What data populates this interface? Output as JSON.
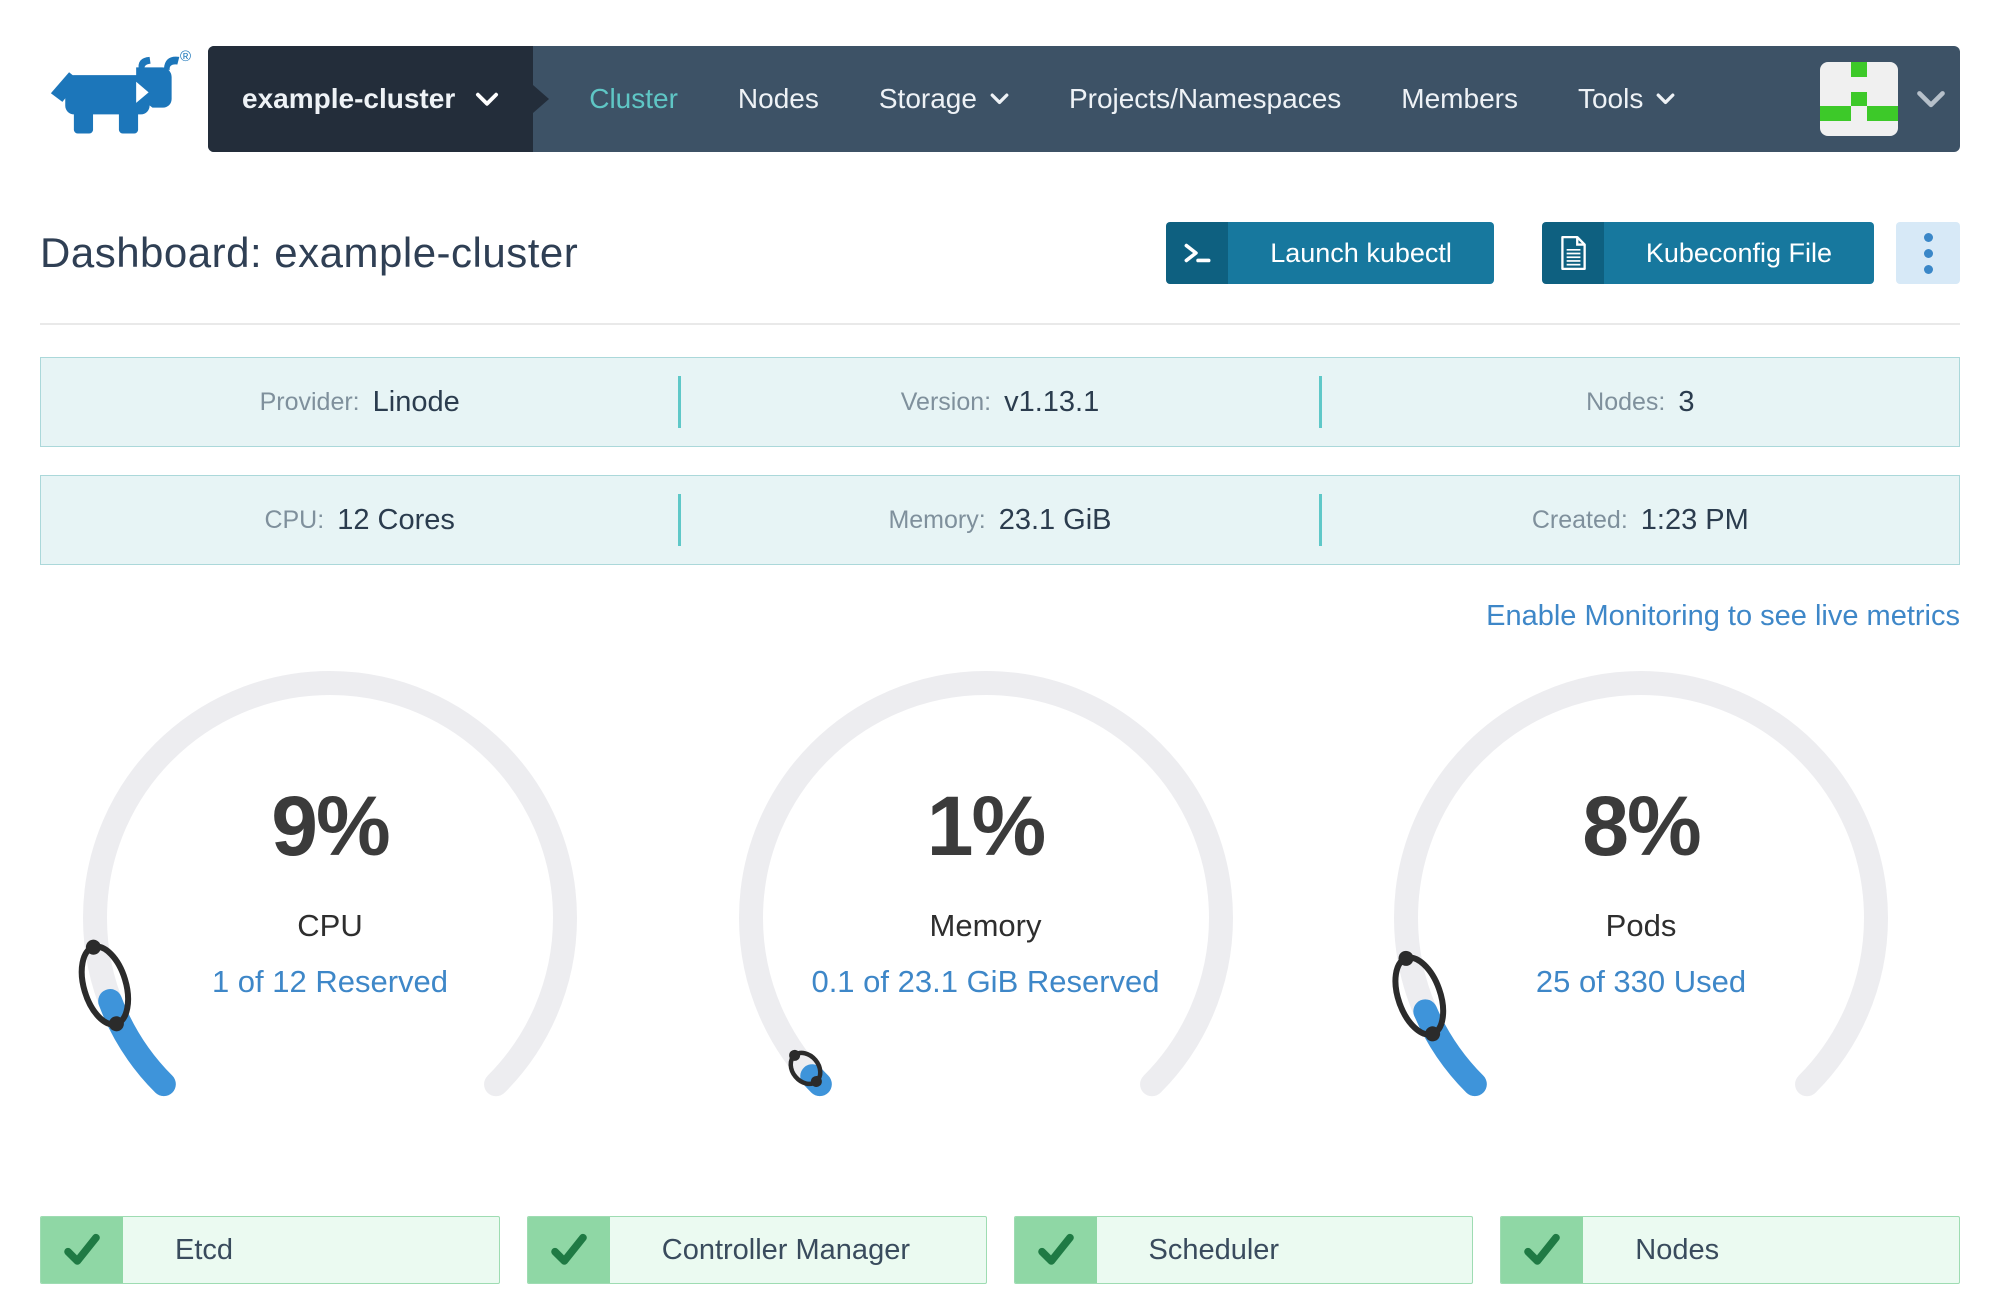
{
  "brand": {
    "trademark": "®"
  },
  "nav": {
    "cluster_selector": {
      "label": "example-cluster"
    },
    "items": [
      {
        "label": "Cluster",
        "active": true,
        "caret": false
      },
      {
        "label": "Nodes",
        "active": false,
        "caret": false
      },
      {
        "label": "Storage",
        "active": false,
        "caret": true
      },
      {
        "label": "Projects/Namespaces",
        "active": false,
        "caret": false
      },
      {
        "label": "Members",
        "active": false,
        "caret": false
      },
      {
        "label": "Tools",
        "active": false,
        "caret": true
      }
    ],
    "avatar_pattern": [
      [
        0,
        0,
        1,
        0,
        0
      ],
      [
        0,
        0,
        0,
        0,
        0
      ],
      [
        0,
        0,
        1,
        0,
        0
      ],
      [
        1,
        1,
        0,
        1,
        1
      ],
      [
        0,
        0,
        0,
        0,
        0
      ]
    ]
  },
  "header": {
    "title": "Dashboard: example-cluster",
    "actions": {
      "launch_kubectl": "Launch kubectl",
      "kubeconfig": "Kubeconfig File"
    }
  },
  "info_rows": [
    {
      "cells": [
        {
          "label": "Provider:",
          "value": "Linode"
        },
        {
          "label": "Version:",
          "value": "v1.13.1"
        },
        {
          "label": "Nodes:",
          "value": "3"
        }
      ]
    },
    {
      "cells": [
        {
          "label": "CPU:",
          "value": "12 Cores"
        },
        {
          "label": "Memory:",
          "value": "23.1 GiB"
        },
        {
          "label": "Created:",
          "value": "1:23 PM"
        }
      ]
    }
  ],
  "monitoring_link": "Enable Monitoring to see live metrics",
  "chart_data": [
    {
      "type": "gauge",
      "title": "CPU",
      "percent": 9,
      "percent_label": "9%",
      "detail": "1 of 12 Reserved",
      "sweep_deg": 270
    },
    {
      "type": "gauge",
      "title": "Memory",
      "percent": 1,
      "percent_label": "1%",
      "detail": "0.1 of 23.1 GiB Reserved",
      "sweep_deg": 270
    },
    {
      "type": "gauge",
      "title": "Pods",
      "percent": 8,
      "percent_label": "8%",
      "detail": "25 of 330 Used",
      "sweep_deg": 270
    }
  ],
  "status_badges": [
    {
      "label": "Etcd",
      "status": "healthy"
    },
    {
      "label": "Controller Manager",
      "status": "healthy"
    },
    {
      "label": "Scheduler",
      "status": "healthy"
    },
    {
      "label": "Nodes",
      "status": "healthy"
    }
  ],
  "colors": {
    "nav_bg": "#3d5266",
    "nav_selector_bg": "#232d3a",
    "nav_active": "#5fc6c5",
    "primary_button": "#17789e",
    "primary_button_icon_bg": "#0e6080",
    "info_bg": "#e7f4f5",
    "info_border": "#abd8da",
    "info_divider": "#5fc8c8",
    "gauge_track": "#ededf0",
    "gauge_fill": "#3e94da",
    "gauge_loop": "#2b2b2b",
    "link_blue": "#3e87c8",
    "badge_icon_bg": "#8fd7a5",
    "badge_bg": "#ebfaf1",
    "badge_border": "#9edcb2",
    "badge_check": "#1f7a44",
    "identicon_green": "#3dc929",
    "logo_blue": "#1c76ba"
  }
}
